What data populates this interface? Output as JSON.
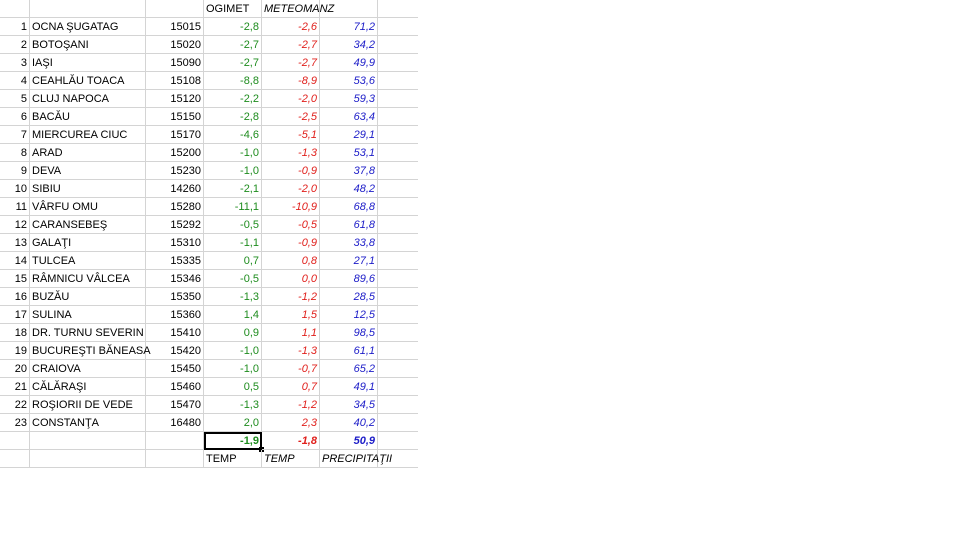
{
  "headers": {
    "ogimet": "OGIMET",
    "meteomanz": "METEOMANZ"
  },
  "stations": [
    {
      "num": "1",
      "name": "OCNA ŞUGATAG",
      "code": "15015",
      "ogimet": "-2,8",
      "meteomanz": "-2,6",
      "precip": "71,2"
    },
    {
      "num": "2",
      "name": "BOTOŞANI",
      "code": "15020",
      "ogimet": "-2,7",
      "meteomanz": "-2,7",
      "precip": "34,2"
    },
    {
      "num": "3",
      "name": "IAŞI",
      "code": "15090",
      "ogimet": "-2,7",
      "meteomanz": "-2,7",
      "precip": "49,9"
    },
    {
      "num": "4",
      "name": "CEAHLĂU TOACA",
      "code": "15108",
      "ogimet": "-8,8",
      "meteomanz": "-8,9",
      "precip": "53,6"
    },
    {
      "num": "5",
      "name": "CLUJ NAPOCA",
      "code": "15120",
      "ogimet": "-2,2",
      "meteomanz": "-2,0",
      "precip": "59,3"
    },
    {
      "num": "6",
      "name": "BACĂU",
      "code": "15150",
      "ogimet": "-2,8",
      "meteomanz": "-2,5",
      "precip": "63,4"
    },
    {
      "num": "7",
      "name": "MIERCUREA CIUC",
      "code": "15170",
      "ogimet": "-4,6",
      "meteomanz": "-5,1",
      "precip": "29,1"
    },
    {
      "num": "8",
      "name": "ARAD",
      "code": "15200",
      "ogimet": "-1,0",
      "meteomanz": "-1,3",
      "precip": "53,1"
    },
    {
      "num": "9",
      "name": "DEVA",
      "code": "15230",
      "ogimet": "-1,0",
      "meteomanz": "-0,9",
      "precip": "37,8"
    },
    {
      "num": "10",
      "name": "SIBIU",
      "code": "14260",
      "ogimet": "-2,1",
      "meteomanz": "-2,0",
      "precip": "48,2"
    },
    {
      "num": "11",
      "name": "VÂRFU OMU",
      "code": "15280",
      "ogimet": "-11,1",
      "meteomanz": "-10,9",
      "precip": "68,8"
    },
    {
      "num": "12",
      "name": "CARANSEBEŞ",
      "code": "15292",
      "ogimet": "-0,5",
      "meteomanz": "-0,5",
      "precip": "61,8"
    },
    {
      "num": "13",
      "name": "GALAŢI",
      "code": "15310",
      "ogimet": "-1,1",
      "meteomanz": "-0,9",
      "precip": "33,8"
    },
    {
      "num": "14",
      "name": "TULCEA",
      "code": "15335",
      "ogimet": "0,7",
      "meteomanz": "0,8",
      "precip": "27,1"
    },
    {
      "num": "15",
      "name": "RÂMNICU VÂLCEA",
      "code": "15346",
      "ogimet": "-0,5",
      "meteomanz": "0,0",
      "precip": "89,6"
    },
    {
      "num": "16",
      "name": "BUZĂU",
      "code": "15350",
      "ogimet": "-1,3",
      "meteomanz": "-1,2",
      "precip": "28,5"
    },
    {
      "num": "17",
      "name": "SULINA",
      "code": "15360",
      "ogimet": "1,4",
      "meteomanz": "1,5",
      "precip": "12,5"
    },
    {
      "num": "18",
      "name": "DR. TURNU SEVERIN",
      "code": "15410",
      "ogimet": "0,9",
      "meteomanz": "1,1",
      "precip": "98,5"
    },
    {
      "num": "19",
      "name": "BUCUREŞTI BĂNEASA",
      "code": "15420",
      "ogimet": "-1,0",
      "meteomanz": "-1,3",
      "precip": "61,1"
    },
    {
      "num": "20",
      "name": "CRAIOVA",
      "code": "15450",
      "ogimet": "-1,0",
      "meteomanz": "-0,7",
      "precip": "65,2"
    },
    {
      "num": "21",
      "name": "CĂLĂRAŞI",
      "code": "15460",
      "ogimet": "0,5",
      "meteomanz": "0,7",
      "precip": "49,1"
    },
    {
      "num": "22",
      "name": "ROŞIORII DE VEDE",
      "code": "15470",
      "ogimet": "-1,3",
      "meteomanz": "-1,2",
      "precip": "34,5"
    },
    {
      "num": "23",
      "name": "CONSTANŢA",
      "code": "16480",
      "ogimet": "2,0",
      "meteomanz": "2,3",
      "precip": "40,2"
    }
  ],
  "summary": {
    "ogimet": "-1,9",
    "meteomanz": "-1,8",
    "precip": "50,9"
  },
  "footer": {
    "ogimet_label": "TEMP",
    "meteomanz_label": "TEMP",
    "precip_label": "PRECIPITAŢII"
  },
  "colors": {
    "ogimet": "#1e8c1e",
    "meteomanz": "#e0201c",
    "precip": "#1c1cc8",
    "gridline": "#d4d4d4"
  }
}
